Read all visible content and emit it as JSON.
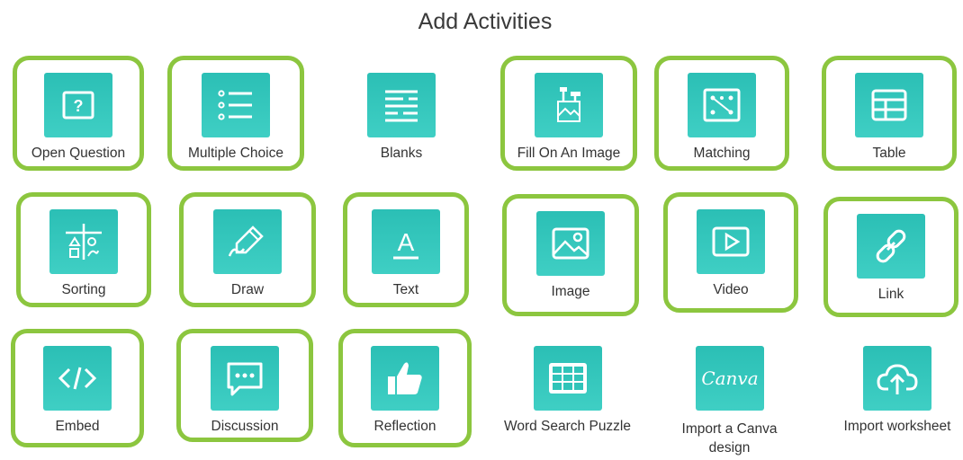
{
  "page": {
    "title": "Add Activities"
  },
  "activities": [
    {
      "label": "Open Question",
      "icon": "question-box-icon",
      "selected": true
    },
    {
      "label": "Multiple Choice",
      "icon": "list-icon",
      "selected": true
    },
    {
      "label": "Blanks",
      "icon": "text-lines-icon",
      "selected": false
    },
    {
      "label": "Fill On An Image",
      "icon": "fill-image-icon",
      "selected": true
    },
    {
      "label": "Matching",
      "icon": "matching-icon",
      "selected": true
    },
    {
      "label": "Table",
      "icon": "table-icon",
      "selected": true
    },
    {
      "label": "Sorting",
      "icon": "sorting-icon",
      "selected": true
    },
    {
      "label": "Draw",
      "icon": "pencil-draw-icon",
      "selected": true
    },
    {
      "label": "Text",
      "icon": "text-a-icon",
      "selected": true
    },
    {
      "label": "Image",
      "icon": "image-icon",
      "selected": true
    },
    {
      "label": "Video",
      "icon": "video-play-icon",
      "selected": true
    },
    {
      "label": "Link",
      "icon": "link-chain-icon",
      "selected": true
    },
    {
      "label": "Embed",
      "icon": "code-embed-icon",
      "selected": true
    },
    {
      "label": "Discussion",
      "icon": "chat-bubble-icon",
      "selected": true
    },
    {
      "label": "Reflection",
      "icon": "thumbs-up-icon",
      "selected": true
    },
    {
      "label": "Word Search Puzzle",
      "icon": "grid-puzzle-icon",
      "selected": false
    },
    {
      "label": "Import a Canva design",
      "icon": "canva-logo-icon",
      "logo_text": "Canva",
      "selected": false
    },
    {
      "label": "Import worksheet",
      "icon": "cloud-upload-icon",
      "selected": false
    }
  ],
  "colors": {
    "accent_teal": "#2bbfb5",
    "selection_green": "#8cc63f"
  }
}
